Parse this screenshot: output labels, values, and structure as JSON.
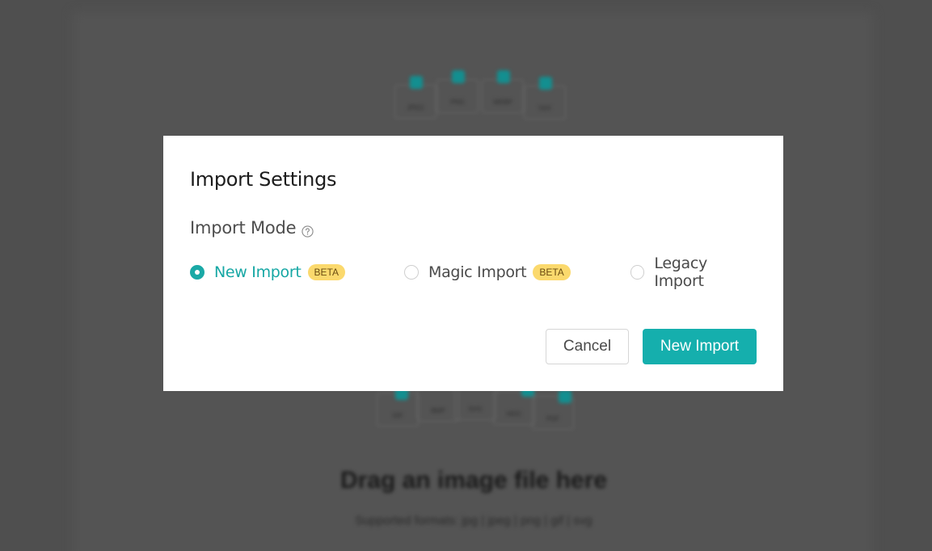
{
  "background": {
    "file_labels": [
      "JPEG",
      "PNG",
      "WEBP",
      "TIFF",
      "GIF",
      "BMP",
      "SVG",
      "HEIC",
      "PDF"
    ],
    "drag_title": "Drag an image file here",
    "supported_text": "Supported formats: jpg | jpeg | png | gif | svg"
  },
  "dialog": {
    "title": "Import Settings",
    "mode_label": "Import Mode",
    "help_icon": "question-circle-icon",
    "options": [
      {
        "label": "New Import",
        "badge": "BETA",
        "selected": true
      },
      {
        "label": "Magic Import",
        "badge": "BETA",
        "selected": false
      },
      {
        "label": "Legacy Import",
        "selected": false
      }
    ],
    "cancel_label": "Cancel",
    "confirm_label": "New Import"
  },
  "colors": {
    "accent": "#15afad",
    "badge": "#fbd96d",
    "overlay": "#4f4f4f"
  }
}
